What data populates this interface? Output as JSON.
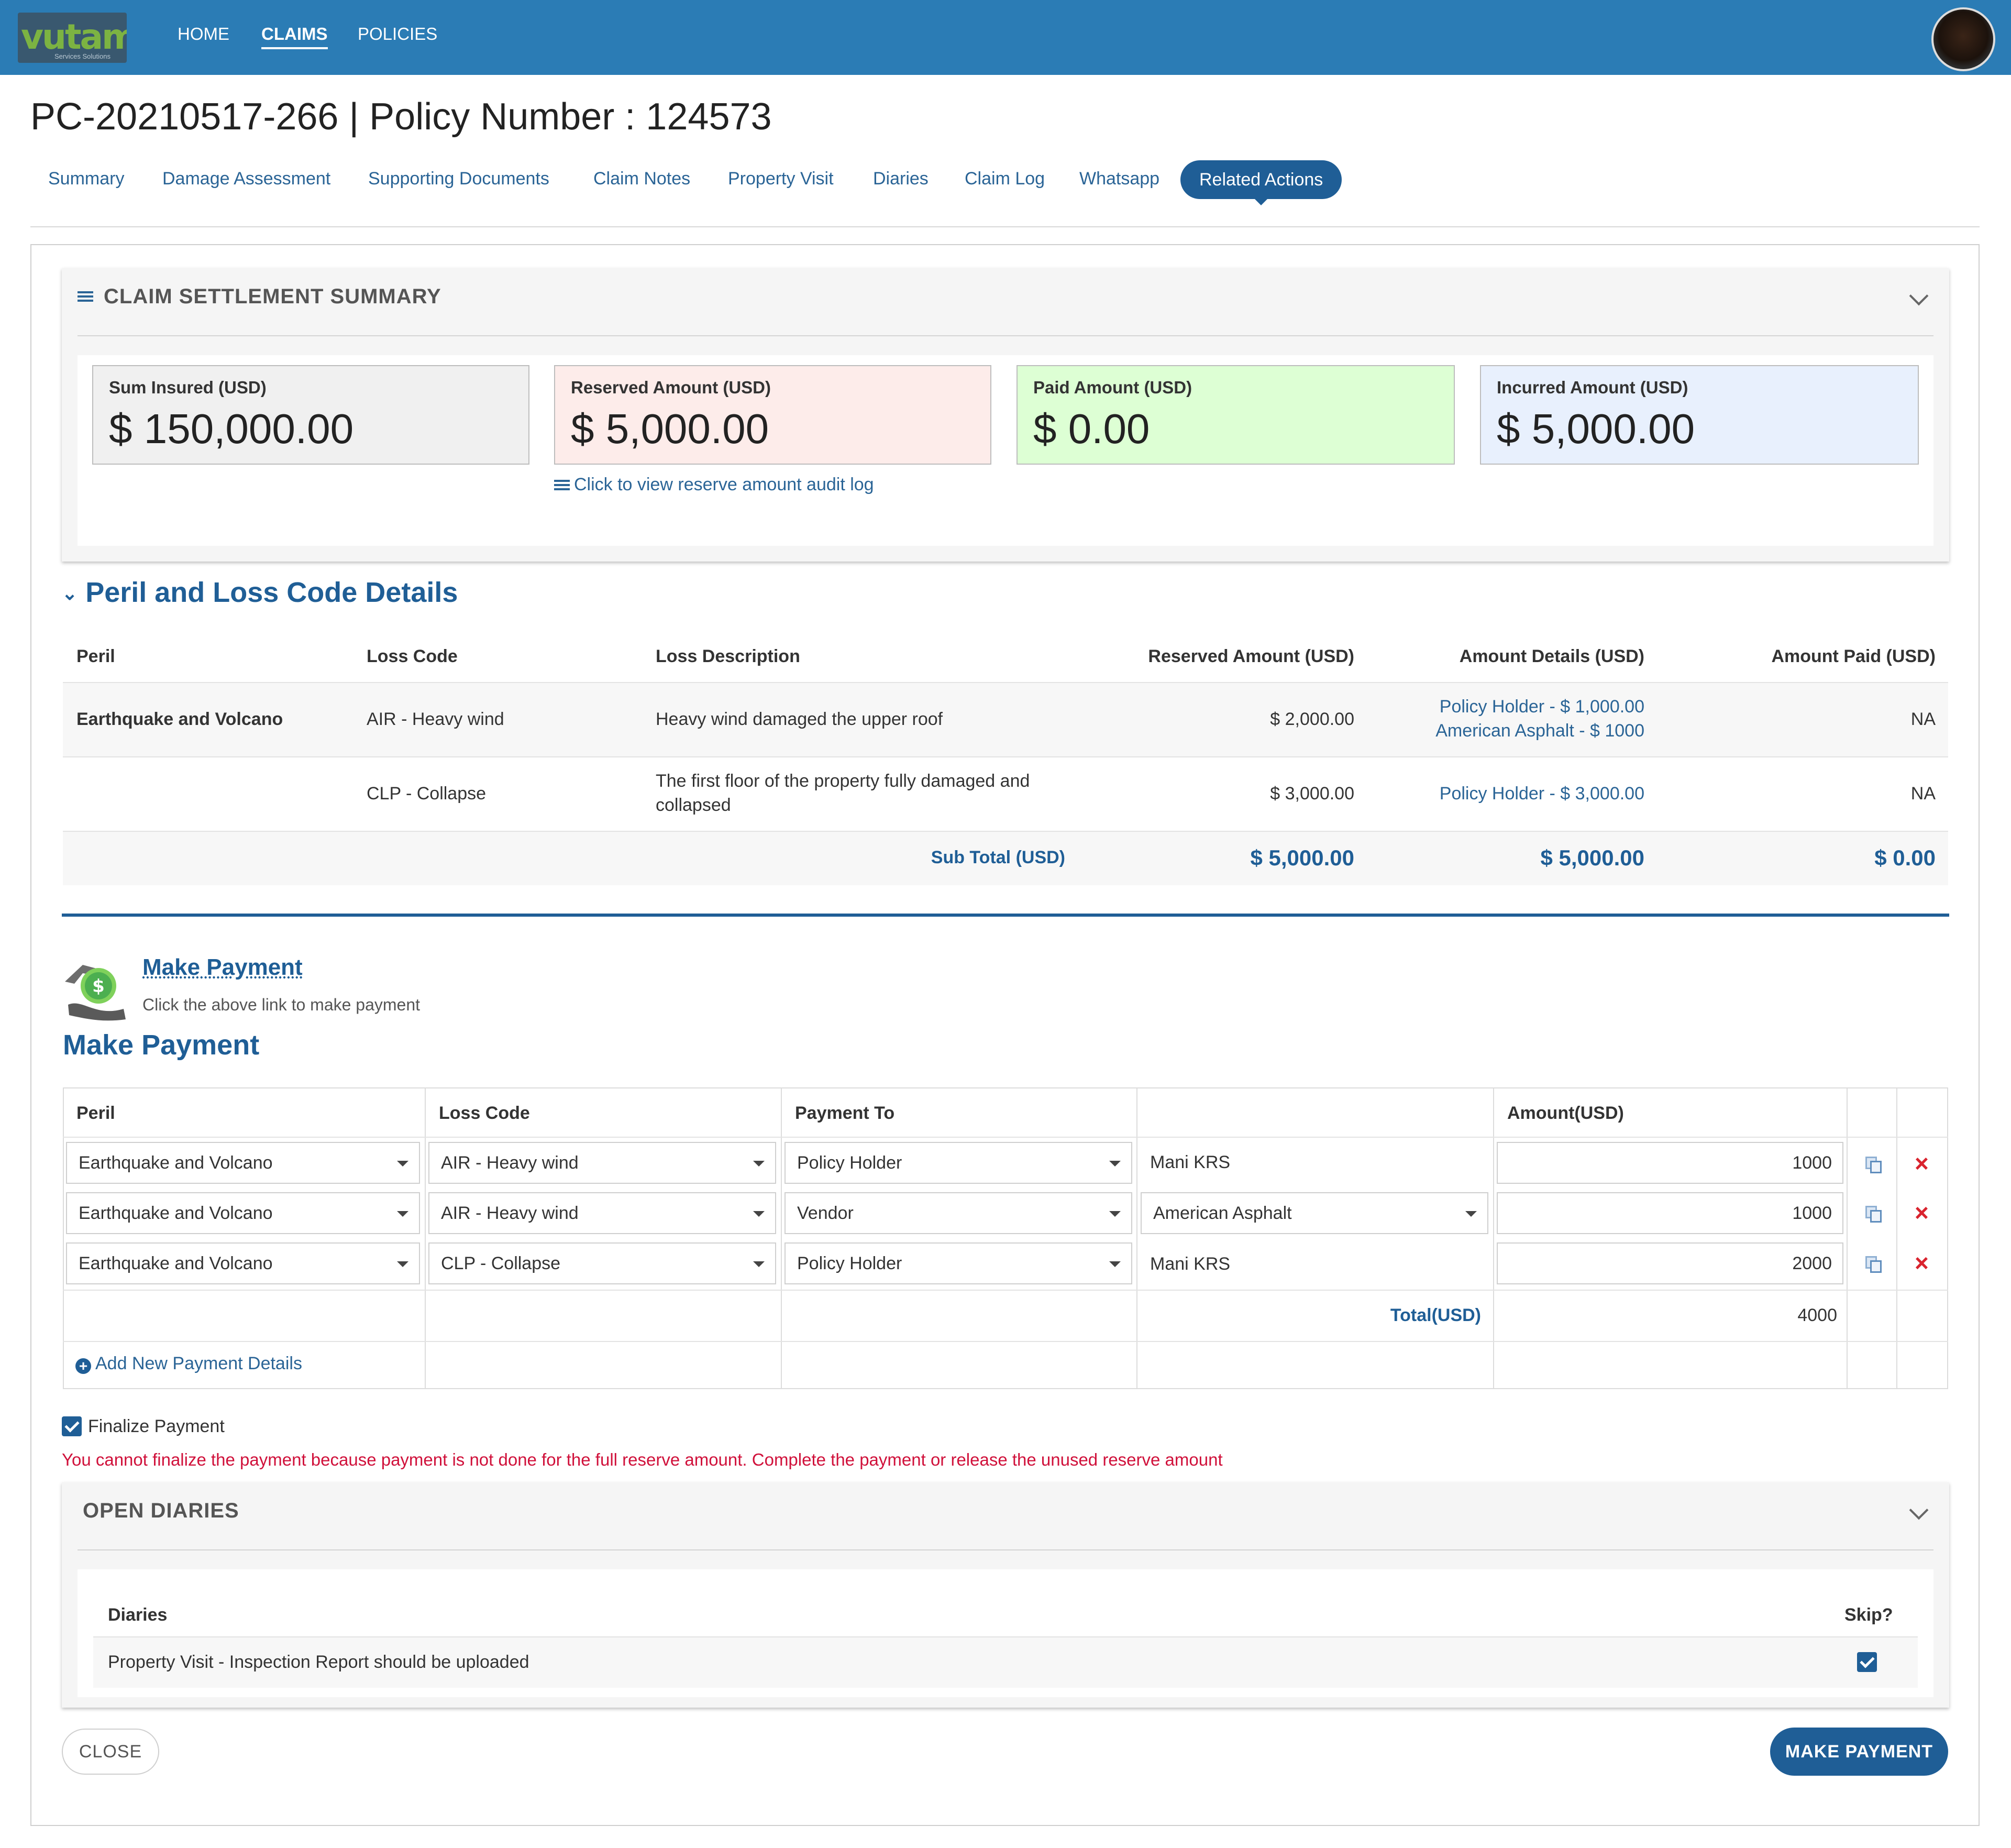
{
  "header": {
    "logo_text": "vutam",
    "logo_subtext": "Services Solutions",
    "nav": [
      "HOME",
      "CLAIMS",
      "POLICIES"
    ],
    "active_nav": "CLAIMS"
  },
  "title": "PC-20210517-266 | Policy Number : 124573",
  "tabs": [
    "Summary",
    "Damage Assessment",
    "Supporting Documents",
    "Claim Notes",
    "Property Visit",
    "Diaries",
    "Claim Log",
    "Whatsapp",
    "Related Actions"
  ],
  "active_tab": "Related Actions",
  "settlement": {
    "title": "CLAIM SETTLEMENT SUMMARY",
    "boxes": [
      {
        "label": "Sum Insured (USD)",
        "value": "$ 150,000.00",
        "color": "#f0f0f0"
      },
      {
        "label": "Reserved Amount (USD)",
        "value": "$ 5,000.00",
        "color": "#fdecea"
      },
      {
        "label": "Paid Amount (USD)",
        "value": "$ 0.00",
        "color": "#ddffd4"
      },
      {
        "label": "Incurred Amount (USD)",
        "value": "$ 5,000.00",
        "color": "#e8f0fd"
      }
    ],
    "audit_link": "Click to view reserve amount audit log"
  },
  "peril": {
    "title": "Peril and Loss Code Details",
    "headers": [
      "Peril",
      "Loss Code",
      "Loss Description",
      "Reserved Amount (USD)",
      "Amount Details (USD)",
      "Amount Paid (USD)"
    ],
    "rows": [
      {
        "peril": "Earthquake and Volcano",
        "loss_code": "AIR - Heavy wind",
        "description": [
          "Heavy wind damaged the upper roof"
        ],
        "reserved": "$ 2,000.00",
        "details": [
          "Policy Holder - $ 1,000.00",
          "American Asphalt - $ 1000"
        ],
        "paid": "NA"
      },
      {
        "peril": "",
        "loss_code": "CLP - Collapse",
        "description": [
          "The first floor of the property fully damaged and",
          "collapsed"
        ],
        "reserved": "$ 3,000.00",
        "details": [
          "Policy Holder - $ 3,000.00"
        ],
        "paid": "NA"
      }
    ],
    "subtotal_label": "Sub Total (USD)",
    "subtotal_reserved": "$ 5,000.00",
    "subtotal_details": "$ 5,000.00",
    "subtotal_paid": "$ 0.00"
  },
  "make_payment": {
    "link": "Make Payment",
    "hint": "Click the above link to make payment",
    "heading": "Make Payment",
    "headers": [
      "Peril",
      "Loss Code",
      "Payment To",
      "",
      "Amount(USD)"
    ],
    "rows": [
      {
        "peril": "Earthquake and Volcano",
        "loss_code": "AIR - Heavy wind",
        "payment_to": "Policy Holder",
        "payee": "Mani KRS",
        "amount": "1000"
      },
      {
        "peril": "Earthquake and Volcano",
        "loss_code": "AIR - Heavy wind",
        "payment_to": "Vendor",
        "payee": "American Asphalt",
        "amount": "1000"
      },
      {
        "peril": "Earthquake and Volcano",
        "loss_code": "CLP - Collapse",
        "payment_to": "Policy Holder",
        "payee": "Mani KRS",
        "amount": "2000"
      }
    ],
    "total_label": "Total(USD)",
    "total": "4000",
    "add_new": "Add New Payment Details",
    "finalize_label": "Finalize Payment",
    "finalize_checked": true,
    "error": "You cannot finalize the payment because payment is not done for the full reserve amount. Complete the payment or release the unused reserve amount"
  },
  "diaries": {
    "title": "OPEN DIARIES",
    "col_diaries": "Diaries",
    "col_skip": "Skip?",
    "rows": [
      {
        "text": "Property Visit - Inspection Report should be uploaded",
        "skip": true
      }
    ]
  },
  "buttons": {
    "close": "CLOSE",
    "make_payment": "MAKE PAYMENT"
  }
}
